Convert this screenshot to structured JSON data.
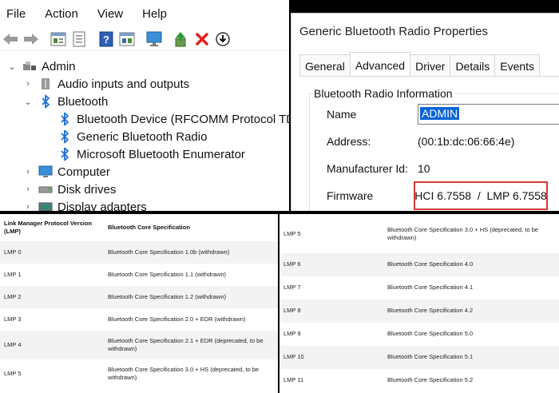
{
  "device_manager": {
    "menu": [
      "File",
      "Action",
      "View",
      "Help"
    ],
    "toolbar_icons": [
      "back-arrow-icon",
      "forward-arrow-icon",
      "properties-window-icon",
      "document-icon",
      "help-icon",
      "scan-window-icon",
      "monitor-icon",
      "update-driver-icon",
      "uninstall-x-icon",
      "download-icon"
    ],
    "tree": {
      "root": "Admin",
      "items": [
        {
          "label": "Audio inputs and outputs",
          "icon": "speaker-icon",
          "expanded": false
        },
        {
          "label": "Bluetooth",
          "icon": "bluetooth-icon",
          "expanded": true,
          "children": [
            "Bluetooth Device (RFCOMM Protocol TDI)",
            "Generic Bluetooth Radio",
            "Microsoft Bluetooth Enumerator"
          ]
        },
        {
          "label": "Computer",
          "icon": "computer-icon",
          "expanded": false
        },
        {
          "label": "Disk drives",
          "icon": "disk-drive-icon",
          "expanded": false
        },
        {
          "label": "Display adapters",
          "icon": "display-adapter-icon",
          "expanded": false
        }
      ]
    }
  },
  "properties": {
    "title": "Generic Bluetooth Radio Properties",
    "tabs": [
      "General",
      "Advanced",
      "Driver",
      "Details",
      "Events"
    ],
    "active_tab": "Advanced",
    "group_title": "Bluetooth Radio Information",
    "fields": {
      "name_label": "Name",
      "name_value": "ADMIN",
      "address_label": "Address:",
      "address_value": "(00:1b:dc:06:66:4e)",
      "manufacturer_label": "Manufacturer Id:",
      "manufacturer_value": "10",
      "firmware_label": "Firmware",
      "firmware_value": "HCI 6.7558  /  LMP 6.7558"
    },
    "highlight_color": "#d93a3a",
    "selection_color": "#0a64d6"
  },
  "lmp_table": {
    "headers": [
      "Link Manager Protocol Version (LMP)",
      "Bluetooth Core Specification"
    ],
    "left_rows": [
      [
        "LMP 0",
        "Bluetooth Core Specification 1.0b (withdrawn)"
      ],
      [
        "LMP 1",
        "Bluetooth Core Specification 1.1 (withdrawn)"
      ],
      [
        "LMP 2",
        "Bluetooth Core Specification 1.2 (withdrawn)"
      ],
      [
        "LMP 3",
        "Bluetooth Core Specification 2.0 + EDR (withdrawn)"
      ],
      [
        "LMP 4",
        "Bluetooth Core Specification 2.1 + EDR (deprecated, to be withdrawn)"
      ],
      [
        "LMP 5",
        "Bluetooth Core Specification 3.0 + HS (deprecated, to be withdrawn)"
      ]
    ],
    "right_rows": [
      [
        "LMP 5",
        "Bluetooth Core Specification 3.0 + HS (deprecated, to be withdrawn)"
      ],
      [
        "LMP 6",
        "Bluetooth Core Specification 4.0"
      ],
      [
        "LMP 7",
        "Bluetooth Core Specification 4.1"
      ],
      [
        "LMP 8",
        "Bluetooth Core Specification 4.2"
      ],
      [
        "LMP 9",
        "Bluetooth Core Specification 5.0"
      ],
      [
        "LMP 10",
        "Bluetooth Core Specification 5.1"
      ],
      [
        "LMP 11",
        "Bluetooth Core Specification 5.2"
      ]
    ]
  }
}
